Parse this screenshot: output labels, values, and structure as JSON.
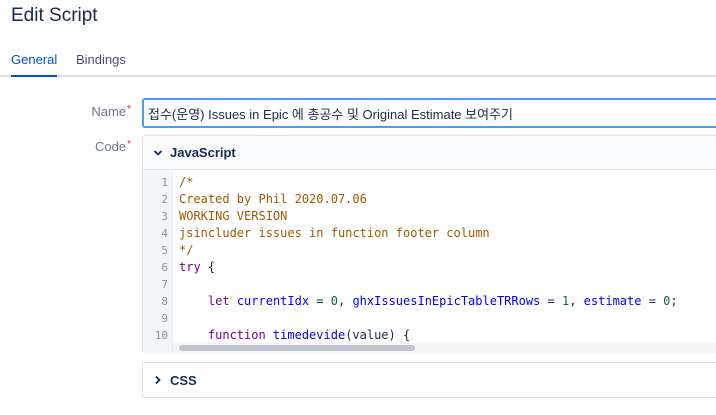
{
  "page": {
    "title": "Edit Script"
  },
  "tabs": [
    {
      "label": "General",
      "active": true
    },
    {
      "label": "Bindings",
      "active": false
    }
  ],
  "form": {
    "name_label": "Name",
    "code_label": "Code",
    "required_mark": "*",
    "name_value": "접수(운영) Issues in Epic 에 총공수 및 Original Estimate 보여주기"
  },
  "editor": {
    "js_title": "JavaScript",
    "css_title": "CSS",
    "line_numbers": [
      "1",
      "2",
      "3",
      "4",
      "5",
      "6",
      "7",
      "8",
      "9",
      "10"
    ],
    "lines": {
      "l1": "/*",
      "l2": "Created by Phil 2020.07.06",
      "l3": "WORKING VERSION",
      "l4": "jsincluder issues in function footer column",
      "l5": "*/",
      "l6_kw": "try",
      "l6_rest": " {",
      "l8_indent": "    ",
      "l8_kw": "let",
      "l8_v1": "currentIdx",
      "l8_eq1": " = ",
      "l8_n1": "0",
      "l8_c1": ", ",
      "l8_v2": "ghxIssuesInEpicTableTRRows",
      "l8_eq2": " = ",
      "l8_n2": "1",
      "l8_c2": ", ",
      "l8_v3": "estimate",
      "l8_eq3": " = ",
      "l8_n3": "0",
      "l8_end": ";",
      "l10_indent": "    ",
      "l10_kw": "function",
      "l10_name": " timedevide",
      "l10_rest": "(value) {"
    }
  },
  "colors": {
    "accent": "#0052cc",
    "focus_border": "#4c9aff",
    "required": "#de350b"
  },
  "icons": {
    "expanded": "chevron-down-icon",
    "collapsed": "chevron-right-icon"
  }
}
